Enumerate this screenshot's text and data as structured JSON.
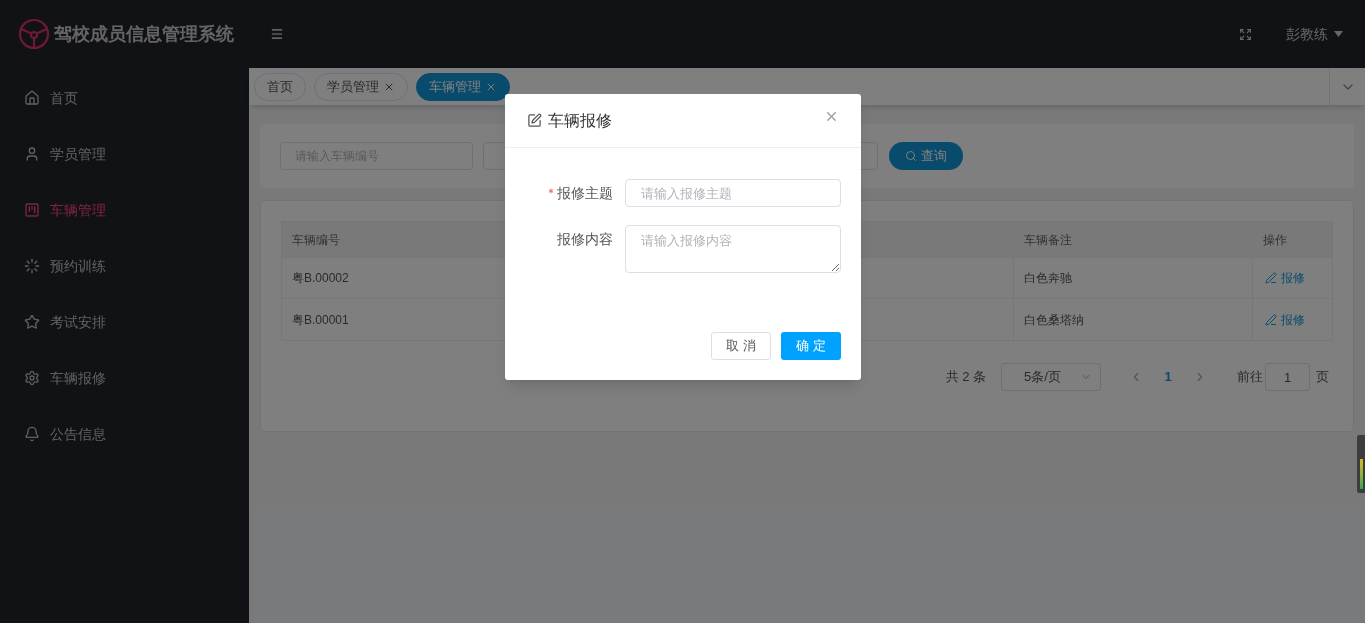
{
  "app": {
    "title": "驾校成员信息管理系统",
    "user": "彭教练"
  },
  "sidebar": {
    "items": [
      {
        "label": "首页",
        "selected": false
      },
      {
        "label": "学员管理",
        "selected": false
      },
      {
        "label": "车辆管理",
        "selected": true
      },
      {
        "label": "预约训练",
        "selected": false
      },
      {
        "label": "考试安排",
        "selected": false
      },
      {
        "label": "车辆报修",
        "selected": false
      },
      {
        "label": "公告信息",
        "selected": false
      }
    ]
  },
  "tabs": [
    {
      "label": "首页",
      "closable": false,
      "selected": false
    },
    {
      "label": "学员管理",
      "closable": true,
      "selected": false
    },
    {
      "label": "车辆管理",
      "closable": true,
      "selected": true
    }
  ],
  "search": {
    "fields": [
      {
        "placeholder": "请输入车辆编号"
      }
    ],
    "button": "查询"
  },
  "table": {
    "columns": [
      "车辆编号",
      "车辆备注",
      "操作"
    ],
    "rows": [
      {
        "plate": "粤B.00002",
        "remark": "白色奔驰",
        "action": "报修"
      },
      {
        "plate": "粤B.00001",
        "remark": "白色桑塔纳",
        "action": "报修"
      }
    ]
  },
  "pagination": {
    "total": "共 2 条",
    "page_size": "5条/页",
    "pages": [
      {
        "label": "1",
        "selected": true
      }
    ],
    "goto_label": "前往",
    "goto_value": "1",
    "page_suffix": "页"
  },
  "dialog": {
    "title": "车辆报修",
    "fields": [
      {
        "kind": "input",
        "label": "报修主题",
        "required": true,
        "placeholder": "请输入报修主题"
      },
      {
        "kind": "textarea",
        "label": "报修内容",
        "required": false,
        "placeholder": "请输入报修内容"
      }
    ],
    "buttons": [
      {
        "kind": "secondary",
        "label": "取 消"
      },
      {
        "kind": "primary",
        "label": "确 定"
      }
    ]
  }
}
